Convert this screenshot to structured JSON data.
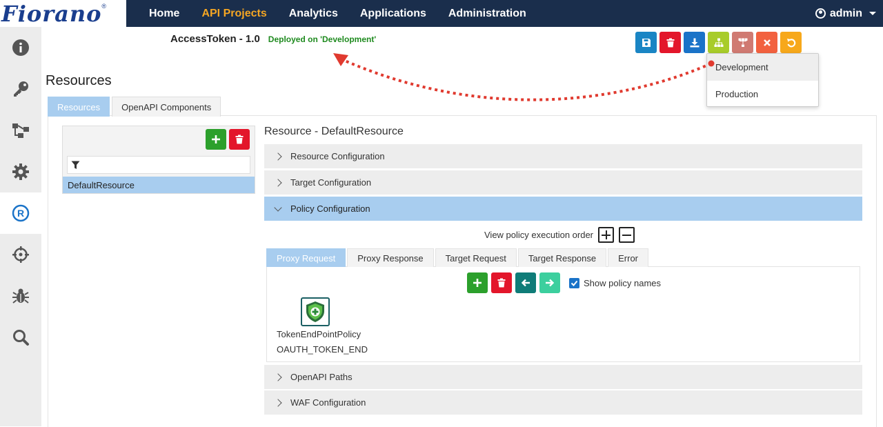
{
  "header": {
    "logo_text": "Fiorano",
    "nav": [
      {
        "label": "Home",
        "active": false
      },
      {
        "label": "API Projects",
        "active": true
      },
      {
        "label": "Analytics",
        "active": false
      },
      {
        "label": "Applications",
        "active": false
      },
      {
        "label": "Administration",
        "active": false
      }
    ],
    "user": "admin"
  },
  "sidebar": {
    "items": [
      {
        "icon": "info-icon",
        "active": false
      },
      {
        "icon": "key-icon",
        "active": false
      },
      {
        "icon": "flow-icon",
        "active": false
      },
      {
        "icon": "gear-icon",
        "active": false
      },
      {
        "icon": "registered-icon",
        "active": true
      },
      {
        "icon": "crosshair-icon",
        "active": false
      },
      {
        "icon": "bug-icon",
        "active": false
      },
      {
        "icon": "search-icon",
        "active": false
      }
    ]
  },
  "project": {
    "title": "AccessToken - 1.0",
    "deployed": "Deployed on 'Development'"
  },
  "toolbar": {
    "buttons": [
      {
        "icon": "save-icon",
        "color": "#1a85c4"
      },
      {
        "icon": "trash-icon",
        "color": "#e3162b"
      },
      {
        "icon": "download-icon",
        "color": "#1a73c8"
      },
      {
        "icon": "deploy-icon",
        "color": "#a8cc2a"
      },
      {
        "icon": "undeploy-icon",
        "color": "#d07a72"
      },
      {
        "icon": "close-icon",
        "color": "#f2613f"
      },
      {
        "icon": "undo-icon",
        "color": "#f7a81b"
      }
    ]
  },
  "deploy_menu": {
    "items": [
      "Development",
      "Production"
    ]
  },
  "resources": {
    "heading": "Resources",
    "tabs": [
      {
        "label": "Resources",
        "active": true
      },
      {
        "label": "OpenAPI Components",
        "active": false
      }
    ],
    "filter_placeholder": "",
    "list": [
      "DefaultResource"
    ]
  },
  "resource_detail": {
    "title": "Resource - DefaultResource",
    "sections": {
      "resource_config": "Resource Configuration",
      "target_config": "Target Configuration",
      "policy_config": "Policy Configuration",
      "openapi_paths": "OpenAPI Paths",
      "waf_config": "WAF Configuration"
    },
    "exec_order_label": "View policy execution order",
    "policy_tabs": [
      {
        "label": "Proxy Request",
        "active": true
      },
      {
        "label": "Proxy Response",
        "active": false
      },
      {
        "label": "Target Request",
        "active": false
      },
      {
        "label": "Target Response",
        "active": false
      },
      {
        "label": "Error",
        "active": false
      }
    ],
    "show_names_label": "Show policy names",
    "show_names_checked": true,
    "policy": {
      "name": "TokenEndPointPolicy",
      "type": "OAUTH_TOKEN_END"
    }
  },
  "colors": {
    "nav_bg": "#1a2e4c",
    "nav_active": "#f5a623",
    "tab_active": "#a8cdef",
    "deployed_green": "#1e8a1e",
    "arrow_red": "#e03a2f"
  }
}
